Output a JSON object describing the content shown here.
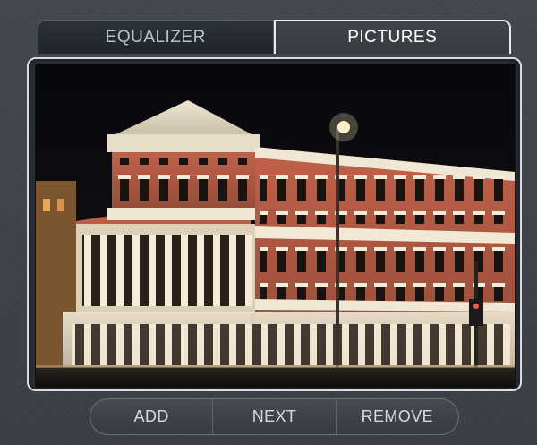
{
  "tabs": [
    {
      "label": "EQUALIZER",
      "active": false
    },
    {
      "label": "PICTURES",
      "active": true
    }
  ],
  "photo": {
    "subject": "illuminated-building-night-photo"
  },
  "buttons": {
    "add": "ADD",
    "next": "NEXT",
    "remove": "REMOVE"
  },
  "colors": {
    "tab_active_border": "#e6eaee",
    "background": "#3c4247",
    "frame_border": "#d7dde3"
  }
}
